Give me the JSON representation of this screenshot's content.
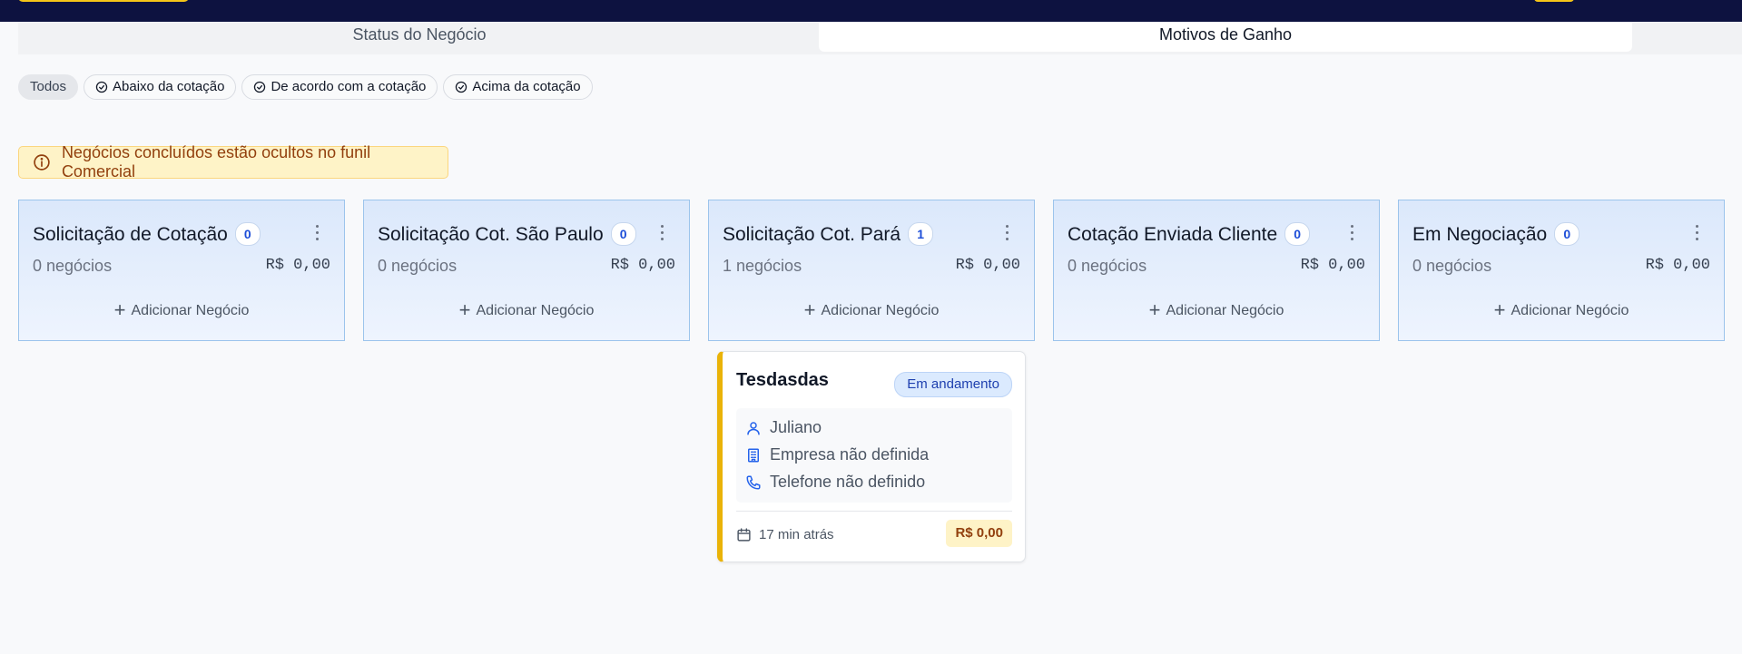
{
  "tabs": [
    {
      "label": "Status do Negócio",
      "active": false
    },
    {
      "label": "Motivos de Ganho",
      "active": true
    }
  ],
  "filters": [
    {
      "label": "Todos",
      "icon": "",
      "selected": true
    },
    {
      "label": "Abaixo da cotação",
      "icon": "check-circle-icon",
      "selected": false
    },
    {
      "label": "De acordo com a cotação",
      "icon": "check-circle-icon",
      "selected": false
    },
    {
      "label": "Acima da cotação",
      "icon": "check-circle-icon",
      "selected": false
    }
  ],
  "alert": {
    "icon": "info-icon",
    "text": "Negócios concluídos estão ocultos no funil Comercial"
  },
  "columns": [
    {
      "title": "Solicitação de Cotação",
      "count": "0",
      "deals": "0 negócios",
      "value": "R$ 0,00",
      "add_label": "Adicionar Negócio"
    },
    {
      "title": "Solicitação Cot. São Paulo",
      "count": "0",
      "deals": "0 negócios",
      "value": "R$ 0,00",
      "add_label": "Adicionar Negócio"
    },
    {
      "title": "Solicitação Cot. Pará",
      "count": "1",
      "deals": "1 negócios",
      "value": "R$ 0,00",
      "add_label": "Adicionar Negócio"
    },
    {
      "title": "Cotação Enviada Cliente",
      "count": "0",
      "deals": "0 negócios",
      "value": "R$ 0,00",
      "add_label": "Adicionar Negócio"
    },
    {
      "title": "Em Negociação",
      "count": "0",
      "deals": "0 negócios",
      "value": "R$ 0,00",
      "add_label": "Adicionar Negócio"
    }
  ],
  "deal_card": {
    "title": "Tesdasdas",
    "status": "Em andamento",
    "contact": "Juliano",
    "company": "Empresa não definida",
    "phone": "Telefone não definido",
    "time": "17 min atrás",
    "value": "R$ 0,00",
    "accent_color": "#eab308"
  },
  "colors": {
    "topbar": "#0d1240",
    "brand_yellow": "#f5c518",
    "column_border": "#9cc4ec",
    "status_blue": "#1e40af"
  }
}
